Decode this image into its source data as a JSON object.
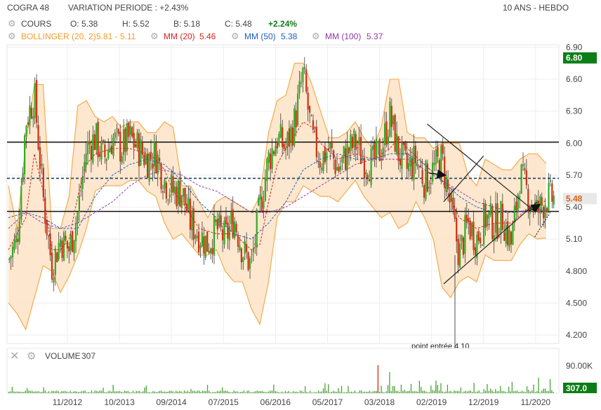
{
  "header": {
    "symbol": "COGRA 48",
    "variation_label": "VARIATION PERIODE : +2.43%",
    "period_label": "10 ANS - HEBDO",
    "cours_label": "COURS",
    "open": "O: 5.38",
    "high": "H: 5.52",
    "low": "B: 5.18",
    "close": "C: 5.48",
    "change": "+2.24%",
    "bollinger_label": "BOLLINGER (20, 2)",
    "bollinger_values": "5.81 - 5.11",
    "mm20_label": "MM (20)",
    "mm20_value": "5.46",
    "mm50_label": "MM (50)",
    "mm50_value": "5.38",
    "mm100_label": "MM (100)",
    "mm100_value": "5.37"
  },
  "volume_panel": {
    "label": "VOLUME",
    "value": "307",
    "axis_tick": "90.00K",
    "badge": "307.0"
  },
  "colors": {
    "up_candle": "#33aa22",
    "down_candle": "#cc3311",
    "bollinger": "#f3a642",
    "bollinger_fill": "#fde3c6",
    "mm20": "#dd2222",
    "mm50": "#1f5fbf",
    "mm100": "#8e3aa8",
    "price_badge": "#0d7d17",
    "change_green": "#0d7d17",
    "volume_bar": "#4aa336"
  },
  "chart_data": {
    "type": "candlestick",
    "x_tick_labels": [
      "11/2012",
      "10/2013",
      "09/2014",
      "07/2015",
      "06/2016",
      "05/2017",
      "03/2018",
      "02/2019",
      "12/2019",
      "11/2020"
    ],
    "y_tick_labels": [
      "6.90",
      "6.60",
      "6.30",
      "6.00",
      "5.70",
      "5.40",
      "5.10",
      "4.800",
      "4.500",
      "4.200"
    ],
    "ylim": [
      4.07,
      7.0
    ],
    "badges": [
      {
        "value": "6.80",
        "price": 6.8,
        "color": "#0d7d17"
      },
      {
        "value": "5.48",
        "price": 5.48,
        "color": "#e8e8e8"
      }
    ],
    "horizontal_lines": [
      {
        "price": 6.01,
        "style": "solid"
      },
      {
        "price": 5.67,
        "style": "dashed"
      },
      {
        "price": 5.36,
        "style": "solid"
      }
    ],
    "close_anchors": [
      [
        0,
        4.9
      ],
      [
        1,
        5.1
      ],
      [
        2,
        6.2
      ],
      [
        3,
        6.45
      ],
      [
        4,
        5.5
      ],
      [
        5,
        4.85
      ],
      [
        6,
        5.1
      ],
      [
        7,
        5.0
      ],
      [
        8,
        5.35
      ],
      [
        9,
        5.95
      ],
      [
        10,
        6.05
      ],
      [
        11,
        5.85
      ],
      [
        12,
        6.05
      ],
      [
        13,
        5.95
      ],
      [
        14,
        6.05
      ],
      [
        15,
        5.95
      ],
      [
        16,
        5.85
      ],
      [
        17,
        5.9
      ],
      [
        18,
        5.65
      ],
      [
        19,
        5.55
      ],
      [
        20,
        5.55
      ],
      [
        21,
        5.25
      ],
      [
        22,
        5.15
      ],
      [
        23,
        5.05
      ],
      [
        24,
        5.2
      ],
      [
        25,
        5.1
      ],
      [
        26,
        5.3
      ],
      [
        27,
        5.0
      ],
      [
        28,
        4.85
      ],
      [
        29,
        5.4
      ],
      [
        30,
        5.85
      ],
      [
        31,
        6.05
      ],
      [
        32,
        5.95
      ],
      [
        33,
        6.2
      ],
      [
        34,
        6.65
      ],
      [
        35,
        6.05
      ],
      [
        36,
        5.85
      ],
      [
        37,
        5.95
      ],
      [
        38,
        5.75
      ],
      [
        39,
        5.9
      ],
      [
        40,
        6.0
      ],
      [
        41,
        5.85
      ],
      [
        42,
        5.8
      ],
      [
        43,
        5.95
      ],
      [
        44,
        6.25
      ],
      [
        45,
        5.9
      ],
      [
        46,
        5.75
      ],
      [
        47,
        5.85
      ],
      [
        48,
        5.65
      ],
      [
        49,
        5.75
      ],
      [
        50,
        5.85
      ],
      [
        51,
        5.4
      ],
      [
        52,
        4.95
      ],
      [
        53,
        5.25
      ],
      [
        54,
        5.1
      ],
      [
        55,
        5.3
      ],
      [
        56,
        5.25
      ],
      [
        57,
        5.3
      ],
      [
        58,
        5.05
      ],
      [
        59,
        5.7
      ],
      [
        60,
        5.5
      ],
      [
        61,
        5.35
      ],
      [
        62,
        5.48
      ]
    ],
    "bollinger_upper": [
      [
        0,
        5.6
      ],
      [
        1,
        5.2
      ],
      [
        2,
        6.0
      ],
      [
        3,
        6.55
      ],
      [
        4,
        6.55
      ],
      [
        5,
        5.2
      ],
      [
        6,
        5.2
      ],
      [
        7,
        5.5
      ],
      [
        8,
        6.35
      ],
      [
        9,
        6.4
      ],
      [
        10,
        6.25
      ],
      [
        11,
        6.2
      ],
      [
        12,
        6.25
      ],
      [
        13,
        6.15
      ],
      [
        14,
        6.2
      ],
      [
        15,
        6.2
      ],
      [
        16,
        6.1
      ],
      [
        17,
        6.1
      ],
      [
        18,
        6.2
      ],
      [
        19,
        6.15
      ],
      [
        20,
        5.6
      ],
      [
        21,
        5.6
      ],
      [
        22,
        5.45
      ],
      [
        23,
        5.3
      ],
      [
        24,
        5.45
      ],
      [
        25,
        5.5
      ],
      [
        26,
        5.45
      ],
      [
        27,
        5.4
      ],
      [
        28,
        5.35
      ],
      [
        29,
        5.5
      ],
      [
        30,
        6.1
      ],
      [
        31,
        6.4
      ],
      [
        32,
        6.45
      ],
      [
        33,
        6.75
      ],
      [
        34,
        6.75
      ],
      [
        35,
        6.55
      ],
      [
        36,
        6.3
      ],
      [
        37,
        6.05
      ],
      [
        38,
        6.05
      ],
      [
        39,
        6.1
      ],
      [
        40,
        6.2
      ],
      [
        41,
        6.05
      ],
      [
        42,
        5.95
      ],
      [
        43,
        6.15
      ],
      [
        44,
        6.6
      ],
      [
        45,
        6.6
      ],
      [
        46,
        6.1
      ],
      [
        47,
        6.05
      ],
      [
        48,
        6.05
      ],
      [
        49,
        5.95
      ],
      [
        50,
        6.0
      ],
      [
        51,
        6.0
      ],
      [
        52,
        6.0
      ],
      [
        53,
        5.7
      ],
      [
        54,
        5.6
      ],
      [
        55,
        5.85
      ],
      [
        56,
        5.8
      ],
      [
        57,
        5.75
      ],
      [
        58,
        5.75
      ],
      [
        59,
        5.85
      ],
      [
        60,
        5.9
      ],
      [
        61,
        5.9
      ],
      [
        62,
        5.81
      ]
    ],
    "bollinger_lower": [
      [
        0,
        4.5
      ],
      [
        1,
        4.4
      ],
      [
        2,
        4.25
      ],
      [
        3,
        4.55
      ],
      [
        4,
        4.85
      ],
      [
        5,
        4.8
      ],
      [
        6,
        4.6
      ],
      [
        7,
        4.75
      ],
      [
        8,
        4.95
      ],
      [
        9,
        5.2
      ],
      [
        10,
        5.55
      ],
      [
        11,
        5.6
      ],
      [
        12,
        5.6
      ],
      [
        13,
        5.6
      ],
      [
        14,
        5.65
      ],
      [
        15,
        5.65
      ],
      [
        16,
        5.55
      ],
      [
        17,
        5.5
      ],
      [
        18,
        5.25
      ],
      [
        19,
        5.1
      ],
      [
        20,
        5.15
      ],
      [
        21,
        5.05
      ],
      [
        22,
        4.95
      ],
      [
        23,
        4.95
      ],
      [
        24,
        5.0
      ],
      [
        25,
        4.8
      ],
      [
        26,
        4.7
      ],
      [
        27,
        4.7
      ],
      [
        28,
        4.45
      ],
      [
        29,
        4.3
      ],
      [
        30,
        4.7
      ],
      [
        31,
        5.3
      ],
      [
        32,
        5.45
      ],
      [
        33,
        5.45
      ],
      [
        34,
        5.6
      ],
      [
        35,
        5.55
      ],
      [
        36,
        5.5
      ],
      [
        37,
        5.5
      ],
      [
        38,
        5.45
      ],
      [
        39,
        5.55
      ],
      [
        40,
        5.65
      ],
      [
        41,
        5.5
      ],
      [
        42,
        5.4
      ],
      [
        43,
        5.3
      ],
      [
        44,
        5.35
      ],
      [
        45,
        5.2
      ],
      [
        46,
        5.25
      ],
      [
        47,
        5.45
      ],
      [
        48,
        5.3
      ],
      [
        49,
        5.1
      ],
      [
        50,
        4.65
      ],
      [
        51,
        4.55
      ],
      [
        52,
        4.7
      ],
      [
        53,
        4.75
      ],
      [
        54,
        4.7
      ],
      [
        55,
        4.95
      ],
      [
        56,
        4.9
      ],
      [
        57,
        4.9
      ],
      [
        58,
        4.9
      ],
      [
        59,
        5.05
      ],
      [
        60,
        5.15
      ],
      [
        61,
        5.1
      ],
      [
        62,
        5.11
      ]
    ],
    "ma20": [
      [
        0,
        5.0
      ],
      [
        2,
        5.3
      ],
      [
        3,
        5.9
      ],
      [
        4,
        5.55
      ],
      [
        5,
        5.0
      ],
      [
        6,
        5.0
      ],
      [
        7,
        5.1
      ],
      [
        8,
        5.5
      ],
      [
        9,
        5.8
      ],
      [
        10,
        5.9
      ],
      [
        12,
        5.95
      ],
      [
        14,
        5.95
      ],
      [
        16,
        5.9
      ],
      [
        17,
        5.85
      ],
      [
        18,
        5.75
      ],
      [
        19,
        5.55
      ],
      [
        20,
        5.45
      ],
      [
        22,
        5.2
      ],
      [
        24,
        5.15
      ],
      [
        26,
        5.15
      ],
      [
        28,
        5.0
      ],
      [
        29,
        5.05
      ],
      [
        30,
        5.45
      ],
      [
        31,
        5.8
      ],
      [
        32,
        5.95
      ],
      [
        34,
        6.2
      ],
      [
        35,
        6.15
      ],
      [
        36,
        6.0
      ],
      [
        38,
        5.85
      ],
      [
        40,
        5.9
      ],
      [
        42,
        5.85
      ],
      [
        44,
        5.95
      ],
      [
        45,
        6.05
      ],
      [
        46,
        5.95
      ],
      [
        48,
        5.8
      ],
      [
        50,
        5.65
      ],
      [
        52,
        5.3
      ],
      [
        54,
        5.2
      ],
      [
        56,
        5.25
      ],
      [
        58,
        5.25
      ],
      [
        60,
        5.4
      ],
      [
        62,
        5.46
      ]
    ],
    "ma50": [
      [
        0,
        5.3
      ],
      [
        2,
        5.35
      ],
      [
        4,
        5.3
      ],
      [
        6,
        5.2
      ],
      [
        8,
        5.2
      ],
      [
        10,
        5.5
      ],
      [
        12,
        5.7
      ],
      [
        14,
        5.8
      ],
      [
        16,
        5.85
      ],
      [
        18,
        5.8
      ],
      [
        20,
        5.65
      ],
      [
        22,
        5.45
      ],
      [
        24,
        5.3
      ],
      [
        26,
        5.15
      ],
      [
        28,
        5.1
      ],
      [
        30,
        5.25
      ],
      [
        32,
        5.45
      ],
      [
        34,
        5.75
      ],
      [
        36,
        5.85
      ],
      [
        38,
        5.9
      ],
      [
        40,
        5.85
      ],
      [
        42,
        5.85
      ],
      [
        44,
        5.9
      ],
      [
        46,
        5.9
      ],
      [
        48,
        5.8
      ],
      [
        50,
        5.65
      ],
      [
        52,
        5.5
      ],
      [
        54,
        5.4
      ],
      [
        56,
        5.35
      ],
      [
        58,
        5.35
      ],
      [
        60,
        5.37
      ],
      [
        62,
        5.38
      ]
    ],
    "ma100": [
      [
        0,
        5.2
      ],
      [
        2,
        5.35
      ],
      [
        4,
        5.25
      ],
      [
        6,
        5.2
      ],
      [
        8,
        5.25
      ],
      [
        10,
        5.35
      ],
      [
        12,
        5.45
      ],
      [
        14,
        5.6
      ],
      [
        16,
        5.7
      ],
      [
        18,
        5.75
      ],
      [
        20,
        5.7
      ],
      [
        22,
        5.6
      ],
      [
        24,
        5.55
      ],
      [
        26,
        5.45
      ],
      [
        28,
        5.35
      ],
      [
        30,
        5.35
      ],
      [
        32,
        5.4
      ],
      [
        34,
        5.5
      ],
      [
        36,
        5.6
      ],
      [
        38,
        5.7
      ],
      [
        40,
        5.8
      ],
      [
        42,
        5.85
      ],
      [
        44,
        5.85
      ],
      [
        46,
        5.85
      ],
      [
        48,
        5.75
      ],
      [
        50,
        5.65
      ],
      [
        52,
        5.55
      ],
      [
        54,
        5.45
      ],
      [
        56,
        5.4
      ],
      [
        58,
        5.35
      ],
      [
        60,
        5.36
      ],
      [
        62,
        5.37
      ]
    ],
    "annotations": [
      {
        "text": "point entrée 4.10",
        "t": 51.5,
        "price": 4.1
      },
      {
        "type": "line",
        "from": [
          48.3,
          6.18
        ],
        "to": [
          60.7,
          5.36
        ]
      },
      {
        "type": "line",
        "from": [
          50.2,
          5.45
        ],
        "to": [
          54.8,
          5.88
        ]
      },
      {
        "type": "line",
        "from": [
          50.2,
          4.68
        ],
        "to": [
          61.0,
          5.45
        ]
      },
      {
        "type": "arrow",
        "from": [
          48.5,
          5.72
        ],
        "to": [
          50.3,
          5.7
        ]
      },
      {
        "type": "arrow",
        "from": [
          60.0,
          5.36
        ],
        "to": [
          61.2,
          5.42
        ]
      },
      {
        "type": "dotted",
        "from": [
          60.7,
          5.12
        ],
        "to": [
          62.5,
          5.35
        ]
      }
    ]
  }
}
